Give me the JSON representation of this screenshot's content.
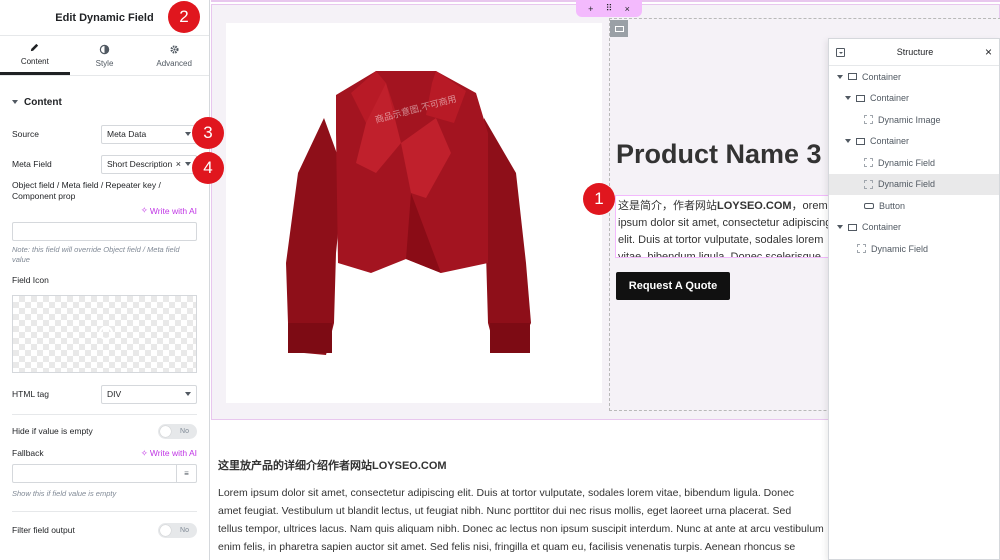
{
  "panel": {
    "title": "Edit Dynamic Field",
    "tabs": [
      {
        "label": "Content",
        "icon": "pencil-icon"
      },
      {
        "label": "Style",
        "icon": "contrast-icon"
      },
      {
        "label": "Advanced",
        "icon": "gear-icon"
      }
    ],
    "section_title": "Content",
    "source_label": "Source",
    "source_value": "Meta Data",
    "meta_field_label": "Meta Field",
    "meta_field_value": "Short Description",
    "object_field_label": "Object field / Meta field / Repeater key / Component prop",
    "write_ai": "Write with AI",
    "override_note": "Note: this field will override Object field / Meta field value",
    "field_icon_label": "Field Icon",
    "html_tag_label": "HTML tag",
    "html_tag_value": "DIV",
    "hide_empty_label": "Hide if value is empty",
    "hide_empty_value": "No",
    "fallback_label": "Fallback",
    "fallback_write_ai": "Write with AI",
    "fallback_note": "Show this if field value is empty",
    "filter_label": "Filter field output",
    "filter_value": "No"
  },
  "badges": [
    "1",
    "2",
    "3",
    "4"
  ],
  "canvas": {
    "toolbar": {
      "add": "+",
      "move": "⠿",
      "close": "×"
    },
    "product_title": "Product Name 3",
    "desc_prefix": "这是简介，作者网站",
    "desc_brand": "LOYSEO.COM",
    "desc_rest": "，orem ipsum dolor sit amet, consectetur adipiscing elit. Duis at tortor vulputate, sodales lorem vitae, bibendum ligula. Donec scelerisque consectetur.",
    "quote_button": "Request A Quote",
    "image_watermark": "商品示意图,不可商用",
    "detail_heading_prefix": "这里放产品的详细介绍作者网站",
    "detail_heading_brand": "LOYSEO.COM",
    "detail_lines": [
      "Lorem ipsum dolor sit amet, consectetur adipiscing elit. Duis at tortor vulputate, sodales lorem vitae, bibendum ligula. Donec",
      "amet feugiat. Vestibulum ut blandit lectus, ut feugiat nibh. Nunc porttitor dui nec risus mollis, eget laoreet urna placerat. Sed",
      "tellus tempor, ultrices lacus. Nam quis aliquam nibh. Donec ac lectus non ipsum suscipit interdum. Nunc at ante at arcu vestibulum",
      "enim felis, in pharetra sapien auctor sit amet. Sed felis nisi, fringilla et quam eu, facilisis venenatis turpis. Aenean rhoncus se"
    ]
  },
  "structure": {
    "title": "Structure",
    "items": [
      {
        "label": "Container"
      },
      {
        "label": "Container"
      },
      {
        "label": "Dynamic Image"
      },
      {
        "label": "Container"
      },
      {
        "label": "Dynamic Field"
      },
      {
        "label": "Dynamic Field"
      },
      {
        "label": "Button"
      },
      {
        "label": "Container"
      },
      {
        "label": "Dynamic Field"
      }
    ]
  },
  "colors": {
    "badge": "#e0161e",
    "ai": "#c036e5",
    "jacket": "#a31420"
  }
}
